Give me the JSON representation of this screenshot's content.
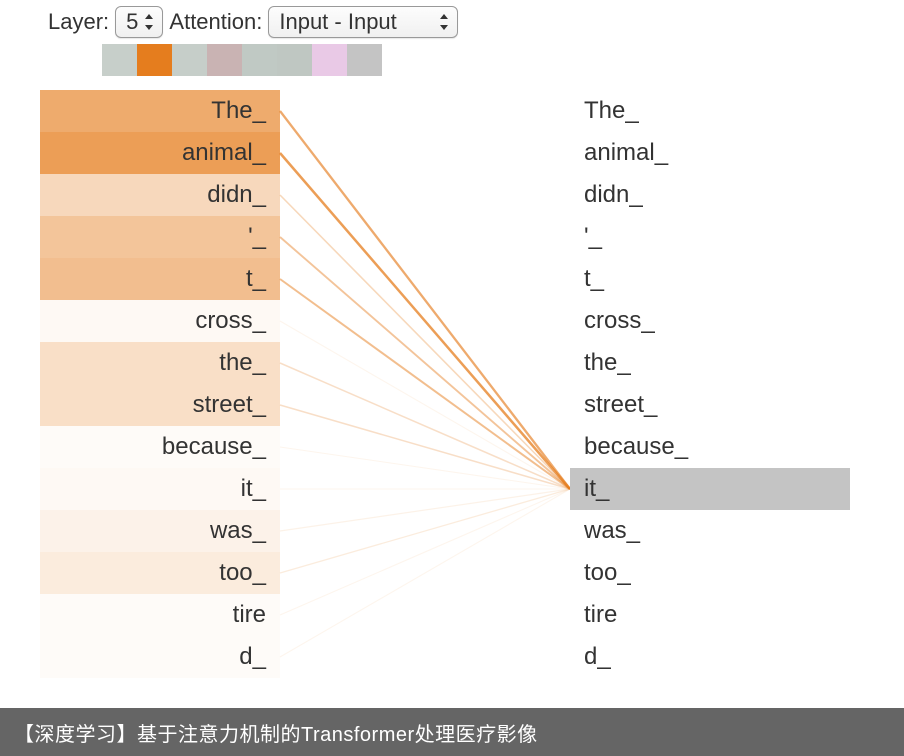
{
  "controls": {
    "layer_label": "Layer:",
    "layer_value": "5",
    "attention_label": "Attention:",
    "attention_value": "Input - Input"
  },
  "heads": [
    {
      "color": "#c7cfca"
    },
    {
      "color": "#e57d1e"
    },
    {
      "color": "#c6cec9"
    },
    {
      "color": "#c9b3b3"
    },
    {
      "color": "#c0c9c4"
    },
    {
      "color": "#bfc7c2"
    },
    {
      "color": "#e9c9e6"
    },
    {
      "color": "#c4c4c4"
    }
  ],
  "tokens_left": [
    {
      "text": "The_",
      "weight": 0.65
    },
    {
      "text": "animal_",
      "weight": 0.75
    },
    {
      "text": "didn_",
      "weight": 0.3
    },
    {
      "text": "'_",
      "weight": 0.45
    },
    {
      "text": "t_",
      "weight": 0.5
    },
    {
      "text": "cross_",
      "weight": 0.05
    },
    {
      "text": "the_",
      "weight": 0.25
    },
    {
      "text": "street_",
      "weight": 0.25
    },
    {
      "text": "because_",
      "weight": 0.03
    },
    {
      "text": "it_",
      "weight": 0.05
    },
    {
      "text": "was_",
      "weight": 0.1
    },
    {
      "text": "too_",
      "weight": 0.15
    },
    {
      "text": "tire",
      "weight": 0.03
    },
    {
      "text": "d_",
      "weight": 0.03
    }
  ],
  "tokens_right": [
    {
      "text": "The_"
    },
    {
      "text": "animal_"
    },
    {
      "text": "didn_"
    },
    {
      "text": "'_"
    },
    {
      "text": "t_"
    },
    {
      "text": "cross_"
    },
    {
      "text": "the_"
    },
    {
      "text": "street_"
    },
    {
      "text": "because_"
    },
    {
      "text": "it_",
      "selected": true
    },
    {
      "text": "was_"
    },
    {
      "text": "too_"
    },
    {
      "text": "tire"
    },
    {
      "text": "d_"
    }
  ],
  "selected_right_index": 9,
  "attention_base_color": "#e57d1e",
  "caption": "【深度学习】基于注意力机制的Transformer处理医疗影像"
}
